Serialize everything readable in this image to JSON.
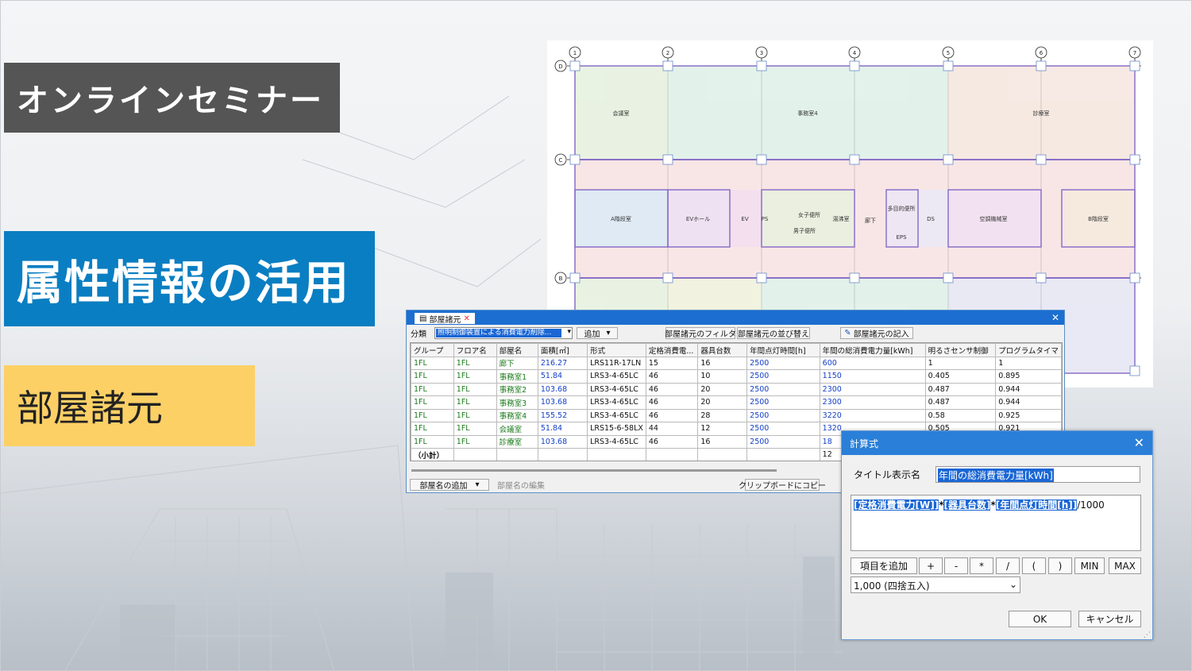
{
  "banners": {
    "seminar": "オンラインセミナー",
    "main_title": "属性情報の活用",
    "sub_title": "部屋諸元"
  },
  "plan": {
    "grid_top": [
      "1",
      "2",
      "3",
      "4",
      "5",
      "6",
      "7"
    ],
    "grid_side": [
      "D",
      "C",
      "B"
    ],
    "rooms": [
      "会議室",
      "事務室4",
      "診療室",
      "A階段室",
      "EVホール",
      "EV",
      "PS",
      "女子便所",
      "男子便所",
      "湯沸室",
      "廊下",
      "多目的便所",
      "DS",
      "EPS",
      "空調機械室",
      "B階段室"
    ]
  },
  "room_window": {
    "tab": "部屋諸元",
    "category_label": "分類",
    "category_value": "照明制御装置による消費電力削除...",
    "add_label": "追加",
    "filter_btn": "部屋諸元のフィルタ",
    "sort_btn": "部屋諸元の並び替え",
    "fill_btn": "部屋諸元の記入",
    "columns": [
      "グループ",
      "フロア名",
      "部屋名",
      "面積[㎡]",
      "形式",
      "定格消費電...",
      "器具台数",
      "年間点灯時間[h]",
      "年間の総消費電力量[kWh]",
      "明るさセンサ制御",
      "プログラムタイマ"
    ],
    "rows": [
      [
        "1FL",
        "1FL",
        "廊下",
        "216.27",
        "LRS11R-17LN",
        "15",
        "16",
        "2500",
        "600",
        "1",
        "1"
      ],
      [
        "1FL",
        "1FL",
        "事務室1",
        "51.84",
        "LRS3-4-65LC",
        "46",
        "10",
        "2500",
        "1150",
        "0.405",
        "0.895"
      ],
      [
        "1FL",
        "1FL",
        "事務室2",
        "103.68",
        "LRS3-4-65LC",
        "46",
        "20",
        "2500",
        "2300",
        "0.487",
        "0.944"
      ],
      [
        "1FL",
        "1FL",
        "事務室3",
        "103.68",
        "LRS3-4-65LC",
        "46",
        "20",
        "2500",
        "2300",
        "0.487",
        "0.944"
      ],
      [
        "1FL",
        "1FL",
        "事務室4",
        "155.52",
        "LRS3-4-65LC",
        "46",
        "28",
        "2500",
        "3220",
        "0.58",
        "0.925"
      ],
      [
        "1FL",
        "1FL",
        "会議室",
        "51.84",
        "LRS15-6-58LX",
        "44",
        "12",
        "2500",
        "1320",
        "0.505",
        "0.921"
      ],
      [
        "1FL",
        "1FL",
        "診療室",
        "103.68",
        "LRS3-4-65LC",
        "46",
        "16",
        "2500",
        "18",
        "",
        ""
      ]
    ],
    "subtotal_label": "（小計）",
    "subtotal_value": "12",
    "add_room_btn": "部屋名の追加",
    "edit_room_btn": "部屋名の編集",
    "copy_btn": "クリップボードにコピー"
  },
  "calc_dialog": {
    "title": "計算式",
    "title_label": "タイトル表示名",
    "title_value": "年間の総消費電力量[kWh]",
    "formula": {
      "t1": "[定格消費電力[W]]",
      "op1": "*",
      "t2": "[器具台数]",
      "op2": "*",
      "t3": "[年間点灯時間[h]]",
      "tail": "/1000"
    },
    "add_item_btn": "項目を追加",
    "ops": [
      "+",
      "-",
      "*",
      "/",
      "(",
      ")",
      "MIN",
      "MAX"
    ],
    "rounding": "1,000 (四捨五入)",
    "ok": "OK",
    "cancel": "キャンセル"
  }
}
